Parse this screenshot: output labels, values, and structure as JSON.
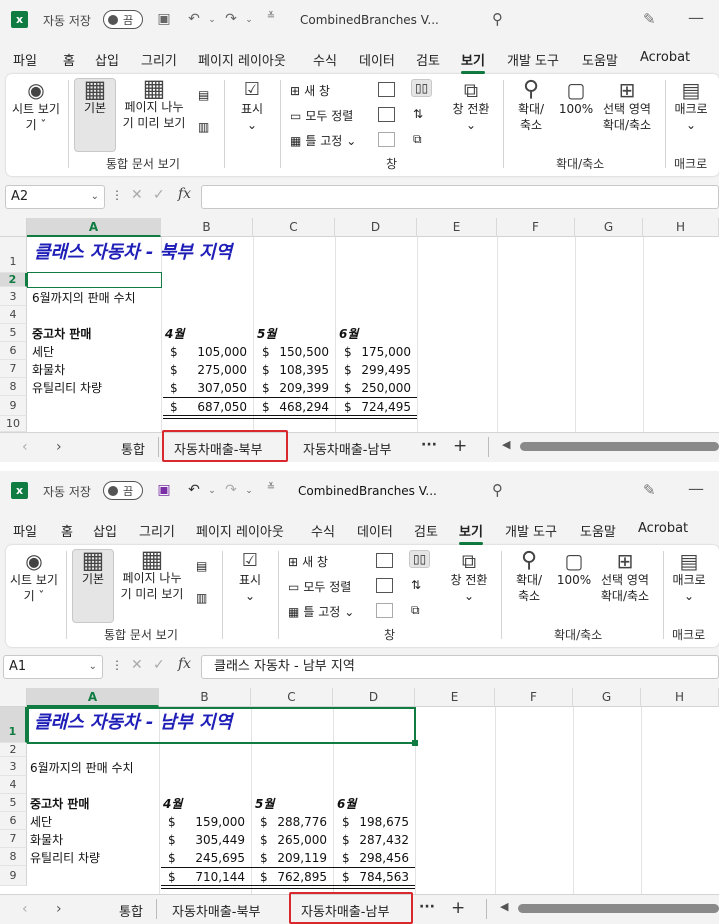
{
  "window": {
    "autosave_label": "자동 저장",
    "autosave_state": "끔",
    "doc_title": "CombinedBranches V..."
  },
  "menu": [
    "파일",
    "홈",
    "삽입",
    "그리기",
    "페이지 레이아웃",
    "수식",
    "데이터",
    "검토",
    "보기",
    "개발 도구",
    "도움말",
    "Acrobat"
  ],
  "ribbon": {
    "sheet_view": "시트 보기",
    "sheet_view_line2": "기 ˇ",
    "normal": "기본",
    "page_break_1": "페이지 나누",
    "page_break_2": "기 미리 보기",
    "show": "표시",
    "group_workbook_views": "통합 문서 보기",
    "new_window": "새 창",
    "arrange_all": "모두 정렬",
    "freeze_panes": "틀 고정",
    "group_window": "창",
    "switch_windows": "창 전환",
    "zoom": "확대/",
    "zoom_2": "축소",
    "zoom_100": "100%",
    "zoom_selection_1": "선택 영역",
    "zoom_selection_2": "확대/축소",
    "group_zoom": "확대/축소",
    "macros": "매크로",
    "group_macros": "매크로"
  },
  "columns": [
    "A",
    "B",
    "C",
    "D",
    "E",
    "F",
    "G",
    "H"
  ],
  "rows": [
    "1",
    "2",
    "3",
    "4",
    "5",
    "6",
    "7",
    "8",
    "9",
    "10"
  ],
  "north": {
    "namebox": "A2",
    "formula": "",
    "title": "클래스 자동차 - 북부 지역",
    "subtitle": "6월까지의 판매 수치",
    "section": "중고차 판매",
    "months": [
      "4월",
      "5월",
      "6월"
    ],
    "items": [
      {
        "label": "세단",
        "v": [
          "105,000",
          "150,500",
          "175,000"
        ]
      },
      {
        "label": "화물차",
        "v": [
          "275,000",
          "108,395",
          "299,495"
        ]
      },
      {
        "label": "유틸리티 차량",
        "v": [
          "307,050",
          "209,399",
          "250,000"
        ]
      }
    ],
    "totals": [
      "687,050",
      "468,294",
      "724,495"
    ]
  },
  "south": {
    "namebox": "A1",
    "formula": "클래스 자동차 - 남부 지역",
    "title": "클래스 자동차 - 남부 지역",
    "subtitle": "6월까지의 판매 수치",
    "section": "중고차 판매",
    "months": [
      "4월",
      "5월",
      "6월"
    ],
    "items": [
      {
        "label": "세단",
        "v": [
          "159,000",
          "288,776",
          "198,675"
        ]
      },
      {
        "label": "화물차",
        "v": [
          "305,449",
          "265,000",
          "287,432"
        ]
      },
      {
        "label": "유틸리티 차량",
        "v": [
          "245,695",
          "209,119",
          "298,456"
        ]
      }
    ],
    "totals": [
      "710,144",
      "762,895",
      "784,563"
    ]
  },
  "currency": "$",
  "tabs": [
    "통합",
    "자동차매출-북부",
    "자동차매출-남부"
  ]
}
